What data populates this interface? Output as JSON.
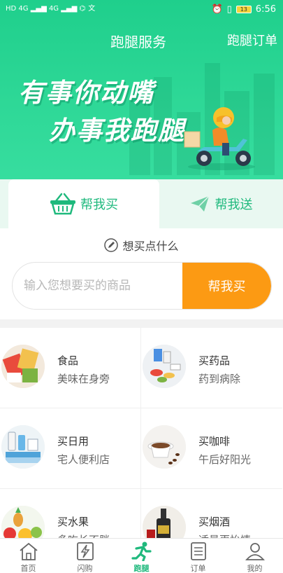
{
  "status_bar": {
    "left_glyphs": "HD 4G ▂▄▆ 4G ▂▄▆ ⌬",
    "app_glyph": "文",
    "time": "6:56",
    "battery": "13"
  },
  "header": {
    "title": "跑腿服务",
    "orders_link": "跑腿订单"
  },
  "banner": {
    "slogan_line1": "有事你动嘴",
    "slogan_line2": "办事我跑腿"
  },
  "tabs": [
    {
      "label": "帮我买",
      "icon": "basket-icon",
      "active": true
    },
    {
      "label": "帮我送",
      "icon": "paper-plane-icon",
      "active": false
    }
  ],
  "want": {
    "title": "想买点什么",
    "placeholder": "输入您想要买的商品",
    "button": "帮我买"
  },
  "categories": [
    {
      "title": "食品",
      "subtitle": "美味在身旁",
      "icon": "food-image"
    },
    {
      "title": "买药品",
      "subtitle": "药到病除",
      "icon": "medicine-image"
    },
    {
      "title": "买日用",
      "subtitle": "宅人便利店",
      "icon": "daily-goods-image"
    },
    {
      "title": "买咖啡",
      "subtitle": "午后好阳光",
      "icon": "coffee-image"
    },
    {
      "title": "买水果",
      "subtitle": "多吃长不胖",
      "icon": "fruit-image"
    },
    {
      "title": "买烟酒",
      "subtitle": "适量更怡情",
      "icon": "liquor-image"
    }
  ],
  "tabbar": [
    {
      "label": "首页",
      "icon": "home-icon",
      "active": false
    },
    {
      "label": "闪购",
      "icon": "lightning-icon",
      "active": false
    },
    {
      "label": "跑腿",
      "icon": "runner-icon",
      "active": true
    },
    {
      "label": "订单",
      "icon": "order-list-icon",
      "active": false
    },
    {
      "label": "我的",
      "icon": "user-icon",
      "active": false
    }
  ],
  "colors": {
    "brand_green": "#1fcf8c",
    "accent_orange": "#fc9a13"
  }
}
